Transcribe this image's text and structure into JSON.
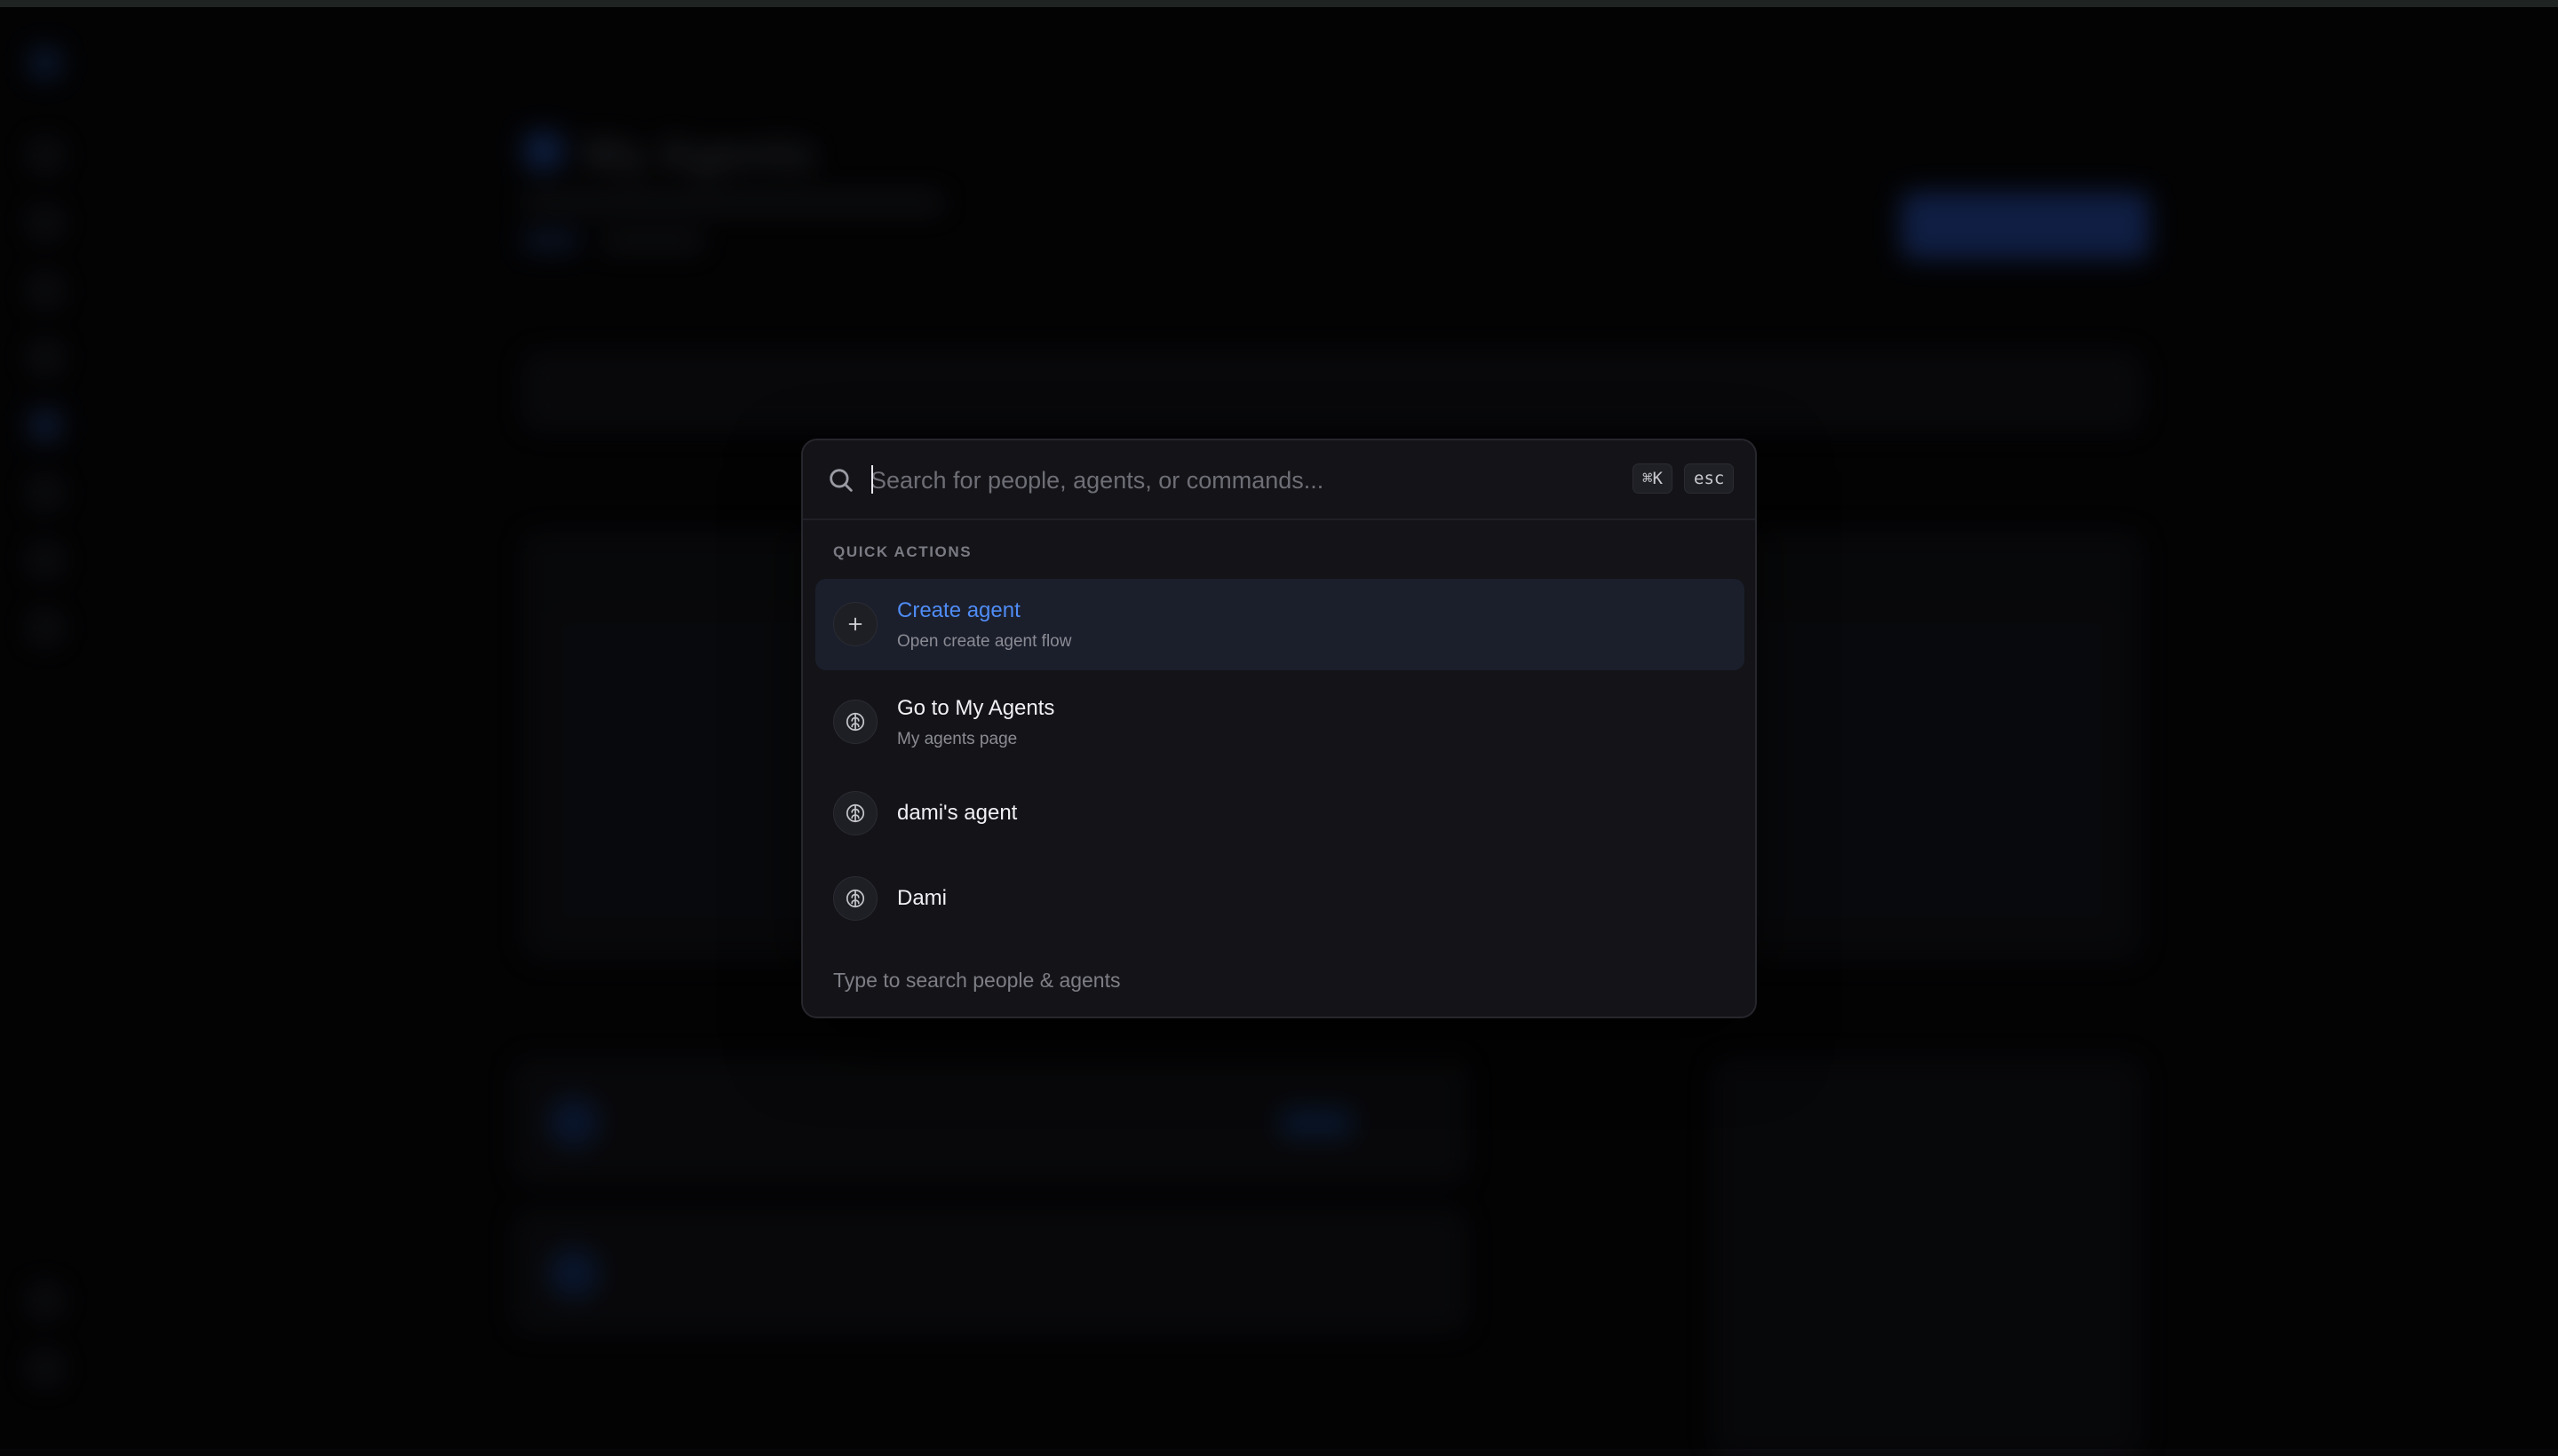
{
  "background": {
    "page_title": "My Agents"
  },
  "palette": {
    "search": {
      "placeholder": "Search for people, agents, or commands...",
      "value": ""
    },
    "shortcut_open": "⌘K",
    "shortcut_close": "esc",
    "section_label": "QUICK ACTIONS",
    "items": [
      {
        "title": "Create agent",
        "subtitle": "Open create agent flow",
        "icon": "plus-icon",
        "active": true
      },
      {
        "title": "Go to My Agents",
        "subtitle": "My agents page",
        "icon": "brain-icon",
        "active": false
      },
      {
        "title": "dami's agent",
        "subtitle": "",
        "icon": "brain-icon",
        "active": false
      },
      {
        "title": "Dami",
        "subtitle": "",
        "icon": "brain-icon",
        "active": false
      }
    ],
    "footer_hint": "Type to search people & agents"
  },
  "colors": {
    "accent": "#4f8cf5",
    "palette_bg": "#131318",
    "active_row": "#1b1f2c"
  }
}
